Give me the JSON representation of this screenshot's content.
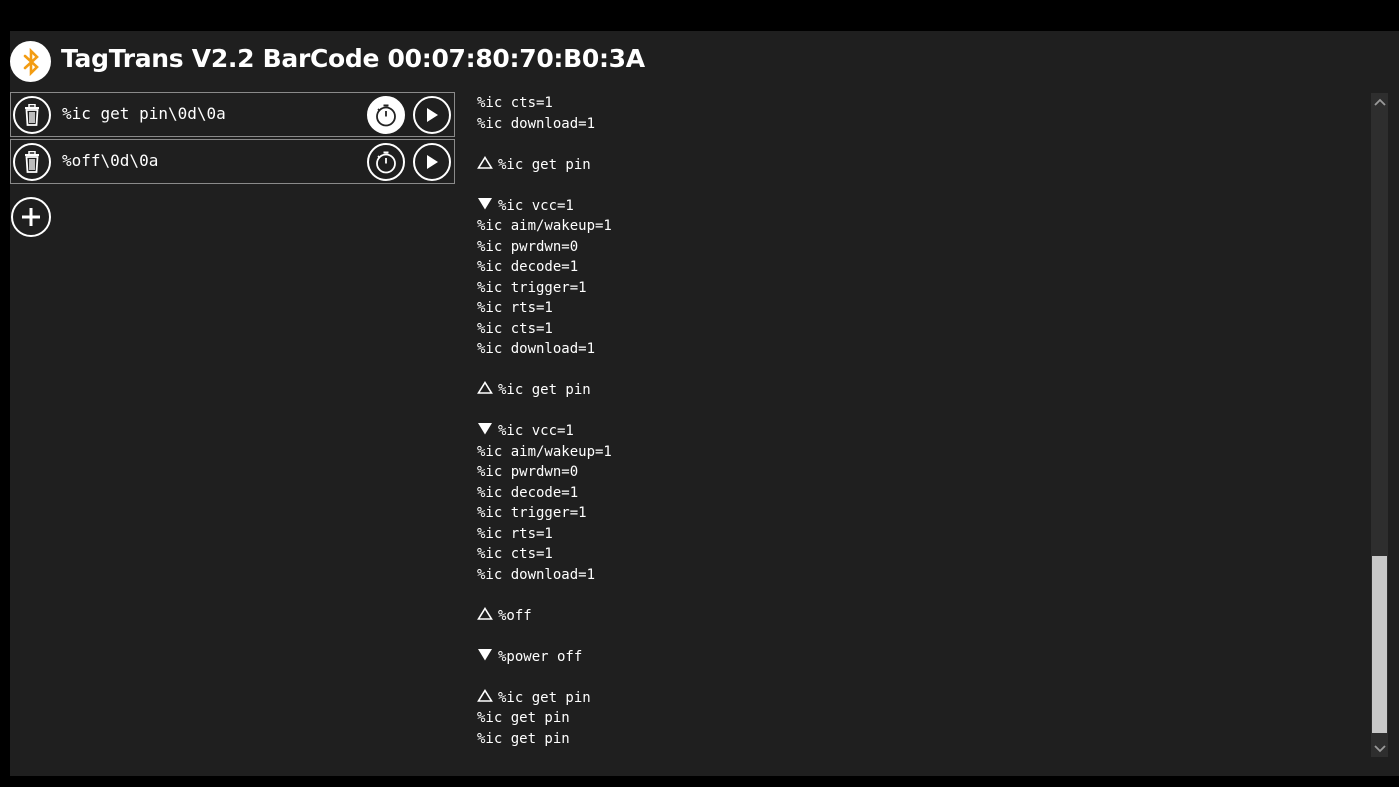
{
  "app": {
    "title": "TagTrans V2.2 BarCode 00:07:80:70:B0:3A",
    "accent_color": "#f39c12",
    "logo_icon": "bluetooth-icon"
  },
  "commands": [
    {
      "text": "%ic get pin\\0d\\0a",
      "timer_active": true
    },
    {
      "text": "%off\\0d\\0a",
      "timer_active": false
    }
  ],
  "log": [
    {
      "dir": "",
      "text": "%ic cts=1"
    },
    {
      "dir": "",
      "text": "%ic download=1"
    },
    {
      "dir": "",
      "text": ""
    },
    {
      "dir": "sent",
      "text": "%ic get pin"
    },
    {
      "dir": "",
      "text": ""
    },
    {
      "dir": "received",
      "text": "%ic vcc=1"
    },
    {
      "dir": "",
      "text": "%ic aim/wakeup=1"
    },
    {
      "dir": "",
      "text": "%ic pwrdwn=0"
    },
    {
      "dir": "",
      "text": "%ic decode=1"
    },
    {
      "dir": "",
      "text": "%ic trigger=1"
    },
    {
      "dir": "",
      "text": "%ic rts=1"
    },
    {
      "dir": "",
      "text": "%ic cts=1"
    },
    {
      "dir": "",
      "text": "%ic download=1"
    },
    {
      "dir": "",
      "text": ""
    },
    {
      "dir": "sent",
      "text": "%ic get pin"
    },
    {
      "dir": "",
      "text": ""
    },
    {
      "dir": "received",
      "text": "%ic vcc=1"
    },
    {
      "dir": "",
      "text": "%ic aim/wakeup=1"
    },
    {
      "dir": "",
      "text": "%ic pwrdwn=0"
    },
    {
      "dir": "",
      "text": "%ic decode=1"
    },
    {
      "dir": "",
      "text": "%ic trigger=1"
    },
    {
      "dir": "",
      "text": "%ic rts=1"
    },
    {
      "dir": "",
      "text": "%ic cts=1"
    },
    {
      "dir": "",
      "text": "%ic download=1"
    },
    {
      "dir": "",
      "text": ""
    },
    {
      "dir": "sent",
      "text": "%off"
    },
    {
      "dir": "",
      "text": ""
    },
    {
      "dir": "received",
      "text": "%power off"
    },
    {
      "dir": "",
      "text": ""
    },
    {
      "dir": "sent",
      "text": "%ic get pin"
    },
    {
      "dir": "",
      "text": "%ic get pin"
    },
    {
      "dir": "",
      "text": "%ic get pin"
    }
  ]
}
